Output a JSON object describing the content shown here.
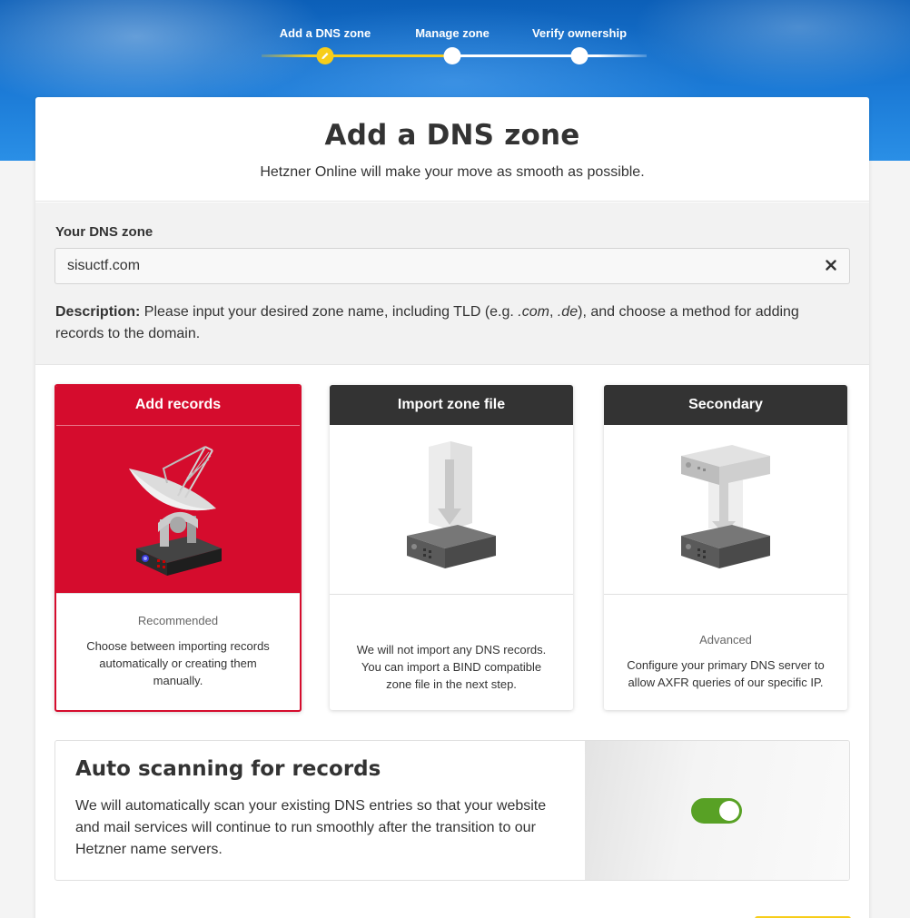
{
  "stepper": {
    "steps": [
      {
        "label": "Add a DNS zone"
      },
      {
        "label": "Manage zone"
      },
      {
        "label": "Verify ownership"
      }
    ]
  },
  "header": {
    "title": "Add a DNS zone",
    "subtitle": "Hetzner Online will make your move as smooth as possible."
  },
  "zone": {
    "label": "Your DNS zone",
    "value": "sisuctf.com",
    "description_bold": "Description:",
    "description_1": " Please input your desired zone name, including TLD (e.g. ",
    "tld_1": ".com",
    "description_2": ", ",
    "tld_2": ".de",
    "description_3": "), and choose a method for adding records to the domain."
  },
  "options": [
    {
      "title": "Add records",
      "tag": "Recommended",
      "text": "Choose between importing records automatically or creating them manually."
    },
    {
      "title": "Import zone file",
      "tag": "",
      "text": "We will not import any DNS records. You can import a BIND compatible zone file in the next step."
    },
    {
      "title": "Secondary",
      "tag": "Advanced",
      "text": "Configure your primary DNS server to allow AXFR queries of our specific IP."
    }
  ],
  "auto_scan": {
    "title": "Auto scanning for records",
    "text": "We will automatically scan your existing DNS entries so that your website and mail services will continue to run smoothly after the transition to our Hetzner name servers.",
    "enabled": true
  },
  "colors": {
    "accent_red": "#d50c2d",
    "accent_yellow": "#f7cd1a",
    "toggle_green": "#58a125"
  }
}
